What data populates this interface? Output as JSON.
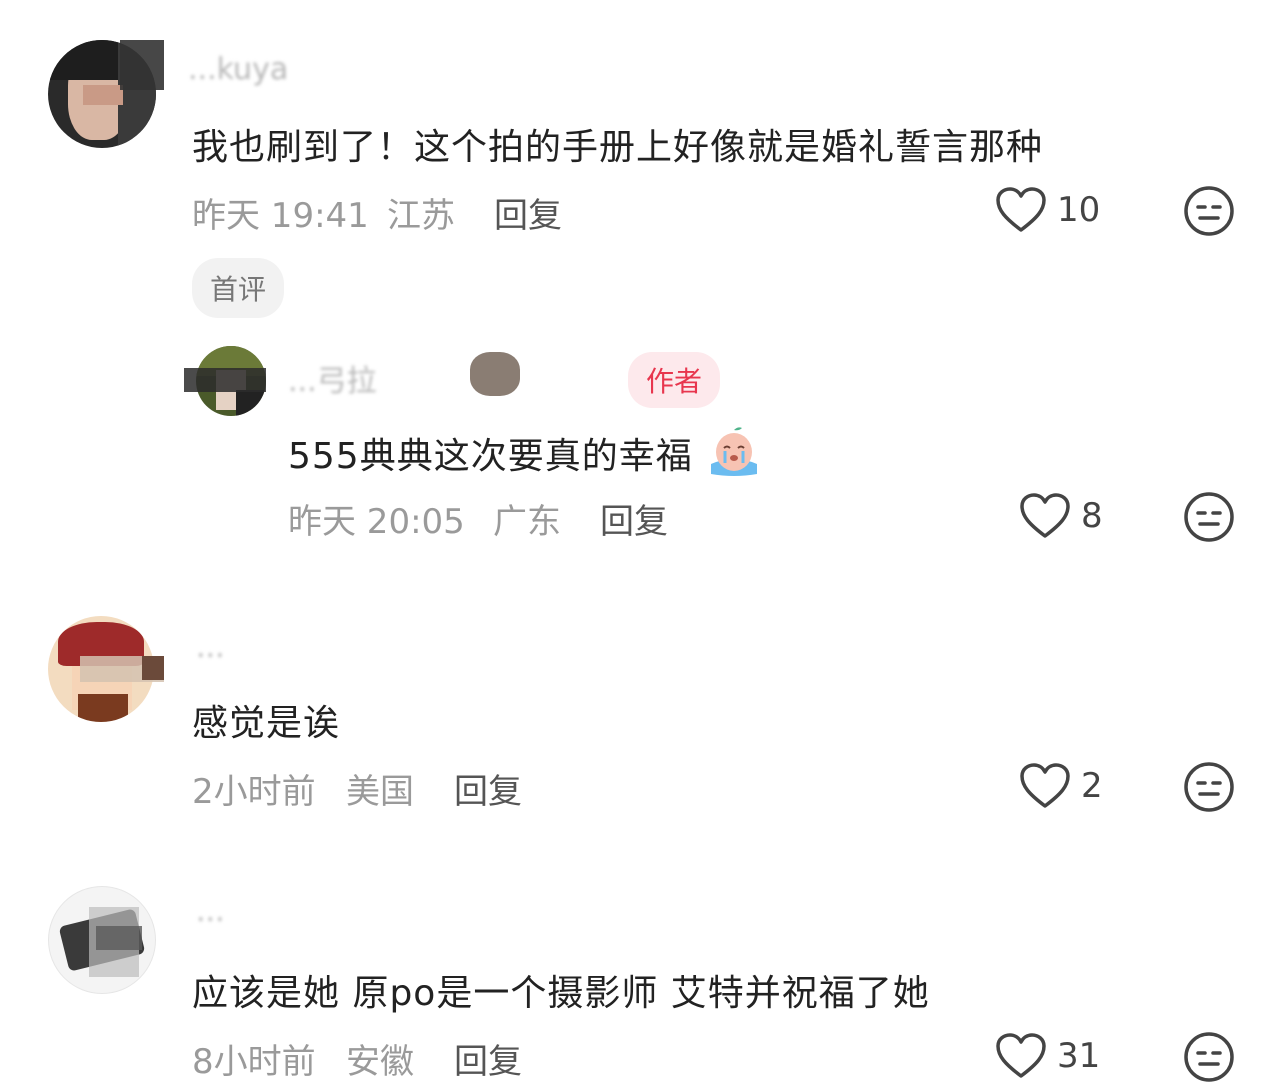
{
  "comments": [
    {
      "username": "...kuya",
      "text": "我也刷到了！这个拍的手册上好像就是婚礼誓言那种",
      "time": "昨天 19:41",
      "location": "江苏",
      "reply_label": "回复",
      "likes": "10",
      "badge": "首评"
    },
    {
      "username": "...弓拉",
      "author_badge": "作者",
      "text": "555典典这次要真的幸福",
      "time": "昨天 20:05",
      "location": "广东",
      "reply_label": "回复",
      "likes": "8"
    },
    {
      "username": "...",
      "text": "感觉是诶",
      "time": "2小时前",
      "location": "美国",
      "reply_label": "回复",
      "likes": "2"
    },
    {
      "username": "...",
      "text": "应该是她 原po是一个摄影师 艾特并祝福了她",
      "time": "8小时前",
      "location": "安徽",
      "reply_label": "回复",
      "likes": "31"
    }
  ],
  "icons": {
    "like": "heart-outline-icon",
    "dislike": "neutral-face-icon",
    "emoji": "crying-peach-emoji"
  },
  "colors": {
    "author_badge_text": "#e8364e",
    "author_badge_bg": "#fde9ec",
    "meta_text": "#9a9a9a"
  }
}
